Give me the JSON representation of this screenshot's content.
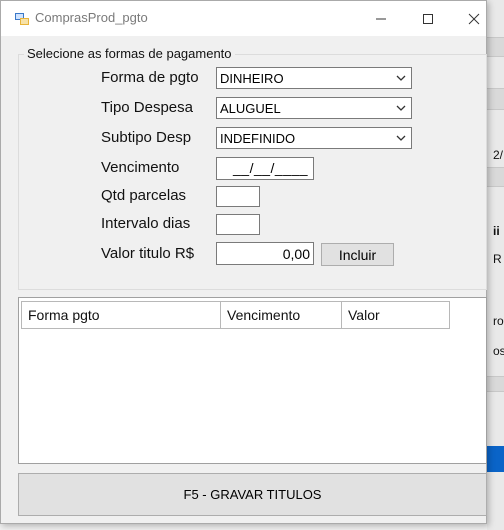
{
  "window": {
    "title": "ComprasProd_pgto"
  },
  "titlebar": {
    "minimize": "—",
    "maximize": "☐",
    "close": "✕"
  },
  "form": {
    "group_title": "Selecione as formas de pagamento",
    "forma_pgto_label": "Forma de pgto",
    "forma_pgto_value": "DINHEIRO",
    "tipo_despesa_label": "Tipo Despesa",
    "tipo_despesa_value": "ALUGUEL",
    "subtipo_label": "Subtipo Desp",
    "subtipo_value": "INDEFINIDO",
    "vencimento_label": "Vencimento",
    "vencimento_value": "__/__/____",
    "qtd_parcelas_label": "Qtd parcelas",
    "qtd_parcelas_value": "",
    "intervalo_label": "Intervalo dias",
    "intervalo_value": "",
    "valor_label": "Valor titulo R$",
    "valor_value": "0,00",
    "incluir_label": "Incluir"
  },
  "grid": {
    "columns": [
      "Forma pgto",
      "Vencimento",
      "Valor"
    ]
  },
  "footer": {
    "gravar_label": "F5 - GRAVAR TITULOS"
  },
  "background_app": {
    "fragments": [
      "2/",
      "ii",
      "R",
      "ro",
      "os"
    ]
  },
  "colors": {
    "accent_blue": "#0a64c8",
    "title_text": "#7a7a7a"
  }
}
